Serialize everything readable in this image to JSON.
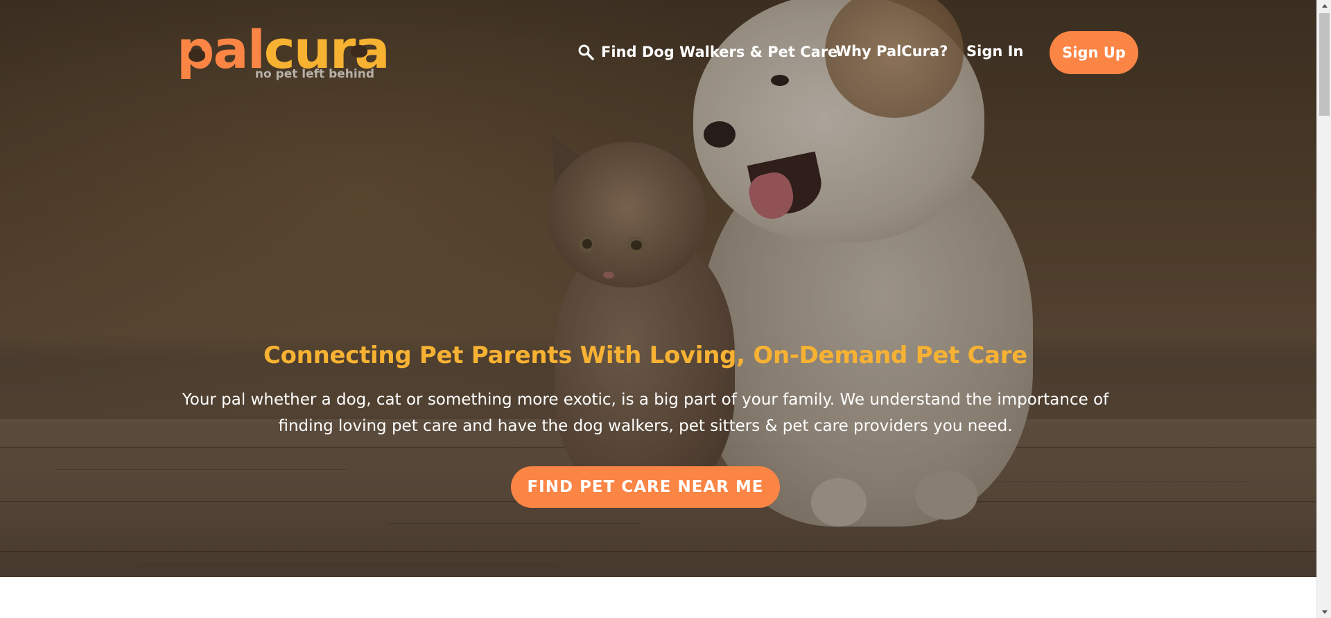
{
  "brand": {
    "logo_part1": "pal",
    "logo_part2": "cura",
    "tagline": "no pet left behind",
    "colors": {
      "orange": "#fb8545",
      "gold": "#f7b232"
    }
  },
  "nav": {
    "find_icon": "search-icon",
    "find_label": "Find Dog Walkers & Pet Care",
    "why_label": "Why PalCura?",
    "signin_label": "Sign In",
    "signup_label": "Sign Up"
  },
  "hero": {
    "headline": "Connecting Pet Parents With Loving, On-Demand Pet Care",
    "subcopy": "Your pal whether a dog, cat or something more exotic, is a big part of your family. We understand the importance of finding loving pet care and have the dog walkers, pet sitters & pet care providers you need.",
    "cta_label": "FIND PET CARE NEAR ME"
  }
}
